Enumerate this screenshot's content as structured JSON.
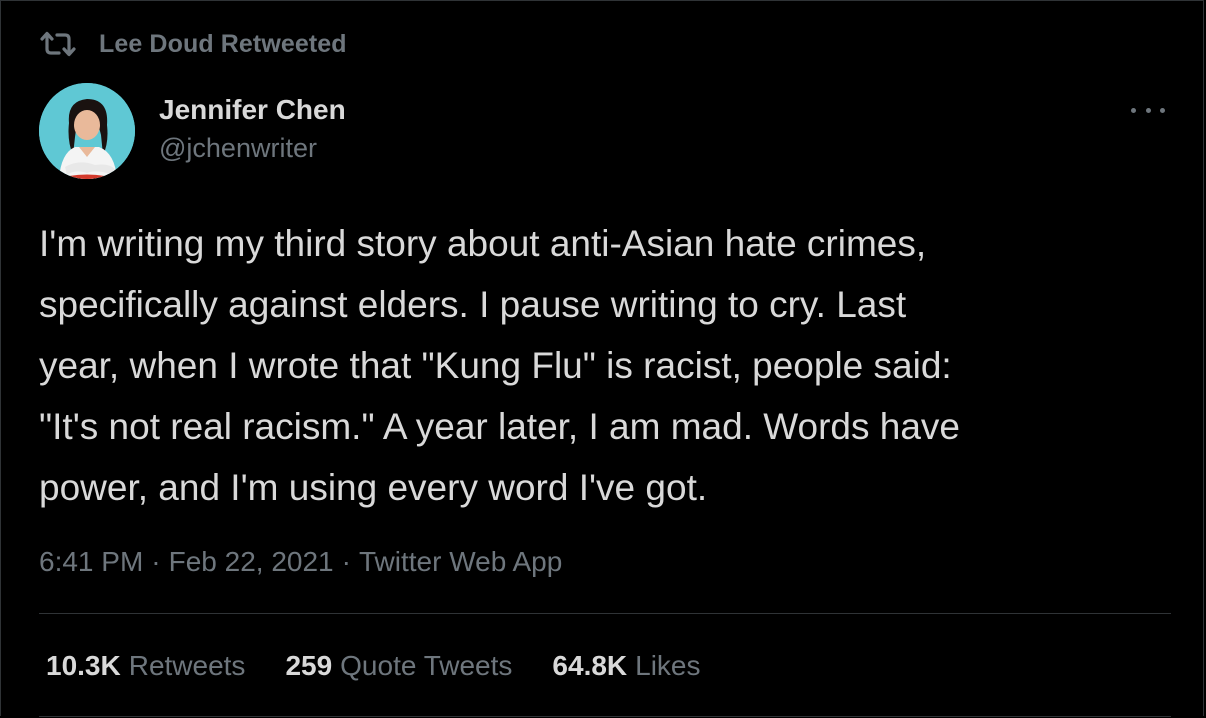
{
  "retweet_context": {
    "label": "Lee Doud Retweeted",
    "icon": "retweet-icon"
  },
  "author": {
    "name": "Jennifer Chen",
    "handle": "@jchenwriter",
    "avatar_bg": "#5fc8d4"
  },
  "more_menu": {
    "icon": "more-horizontal-icon"
  },
  "tweet": {
    "text": "I'm writing my third story about anti-Asian hate crimes,\nspecifically against elders. I pause writing to cry. Last\nyear, when I wrote that \"Kung Flu\" is racist, people said:\n\"It's not real racism.\" A year later, I am mad. Words have\npower, and I'm using every word I've got.",
    "time": "6:41 PM",
    "date": "Feb 22, 2021",
    "source": "Twitter Web App",
    "separator": "·"
  },
  "stats": [
    {
      "count": "10.3K",
      "label": "Retweets"
    },
    {
      "count": "259",
      "label": "Quote Tweets"
    },
    {
      "count": "64.8K",
      "label": "Likes"
    }
  ],
  "colors": {
    "background": "#000000",
    "primary_text": "#d9d9d9",
    "secondary_text": "#6e767d",
    "border": "#2f3336"
  }
}
